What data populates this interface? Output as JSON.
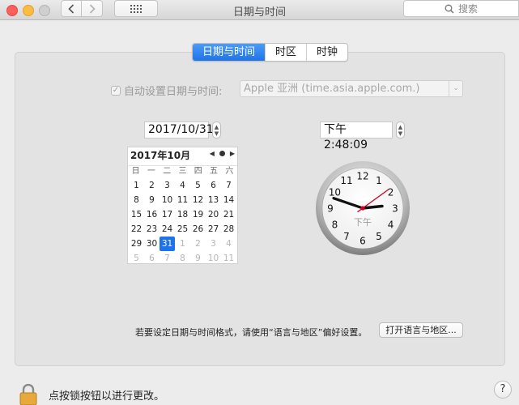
{
  "window": {
    "title": "日期与时间",
    "search_placeholder": "搜索"
  },
  "tabs": [
    {
      "label": "日期与时间",
      "active": true
    },
    {
      "label": "时区",
      "active": false
    },
    {
      "label": "时钟",
      "active": false
    }
  ],
  "auto_set": {
    "label": "自动设置日期与时间:",
    "checked": true,
    "server": "Apple 亚洲 (time.asia.apple.com.)"
  },
  "date_field": "2017/10/31",
  "time_field": "下午  2:48:09",
  "calendar": {
    "month_label": "2017年10月",
    "weekdays": [
      "日",
      "一",
      "二",
      "三",
      "四",
      "五",
      "六"
    ],
    "days": [
      {
        "d": "1"
      },
      {
        "d": "2"
      },
      {
        "d": "3"
      },
      {
        "d": "4"
      },
      {
        "d": "5"
      },
      {
        "d": "6"
      },
      {
        "d": "7"
      },
      {
        "d": "8"
      },
      {
        "d": "9"
      },
      {
        "d": "10"
      },
      {
        "d": "11"
      },
      {
        "d": "12"
      },
      {
        "d": "13"
      },
      {
        "d": "14"
      },
      {
        "d": "15"
      },
      {
        "d": "16"
      },
      {
        "d": "17"
      },
      {
        "d": "18"
      },
      {
        "d": "19"
      },
      {
        "d": "20"
      },
      {
        "d": "21"
      },
      {
        "d": "22"
      },
      {
        "d": "23"
      },
      {
        "d": "24"
      },
      {
        "d": "25"
      },
      {
        "d": "26"
      },
      {
        "d": "27"
      },
      {
        "d": "28"
      },
      {
        "d": "29"
      },
      {
        "d": "30"
      },
      {
        "d": "31",
        "selected": true
      },
      {
        "d": "1",
        "other": true
      },
      {
        "d": "2",
        "other": true
      },
      {
        "d": "3",
        "other": true
      },
      {
        "d": "4",
        "other": true
      },
      {
        "d": "5",
        "other": true
      },
      {
        "d": "6",
        "other": true
      },
      {
        "d": "7",
        "other": true
      },
      {
        "d": "8",
        "other": true
      },
      {
        "d": "9",
        "other": true
      },
      {
        "d": "10",
        "other": true
      },
      {
        "d": "11",
        "other": true
      }
    ]
  },
  "clock": {
    "ampm": "下午",
    "hour": 2,
    "minute": 48,
    "second": 9,
    "numerals": [
      "12",
      "1",
      "2",
      "3",
      "4",
      "5",
      "6",
      "7",
      "8",
      "9",
      "10",
      "11"
    ]
  },
  "format_hint": "若要设定日期与时间格式，请使用“语言与地区”偏好设置。",
  "open_region_button": "打开语言与地区...",
  "lock_text": "点按锁按钮以进行更改。",
  "help_label": "?",
  "colors": {
    "accent": "#1f73ea",
    "second_hand": "#d0021b"
  },
  "icons": [
    "back-icon",
    "forward-icon",
    "grid-icon",
    "search-icon",
    "lock-icon",
    "help-icon"
  ]
}
